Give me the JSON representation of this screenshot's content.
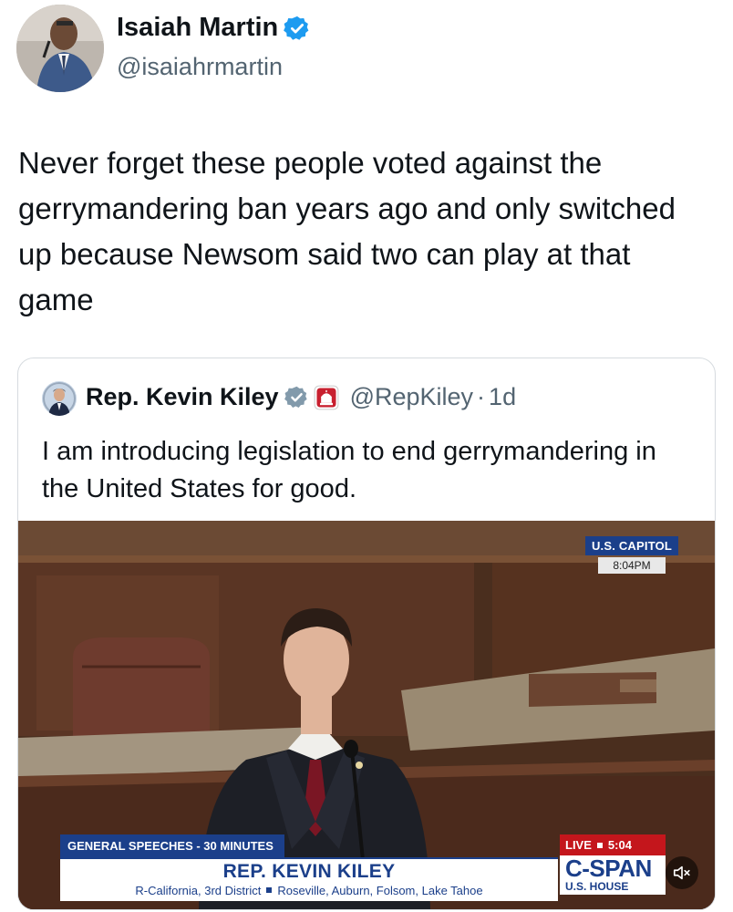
{
  "tweet": {
    "author_name": "Isaiah Martin",
    "handle": "@isaiahrmartin",
    "text": "Never forget these people voted against the gerrymandering ban years ago and only switched up because Newsom said two can play at that game"
  },
  "quoted_tweet": {
    "author_name": "Rep. Kevin Kiley",
    "handle": "@RepKiley",
    "separator": "·",
    "time": "1d",
    "text": "I am introducing legislation to end gerrymandering in the United States for good.",
    "video": {
      "location_label": "U.S. CAPITOL",
      "location_time": "8:04PM",
      "program_label": "GENERAL SPEECHES - 30 MINUTES",
      "speaker_name": "REP. KEVIN KILEY",
      "speaker_party": "R-California, 3rd District",
      "speaker_area": "Roseville, Auburn, Folsom, Lake Tahoe",
      "live_label": "LIVE",
      "live_time": "5:04",
      "network_name": "C-SPAN",
      "network_sub": "U.S. HOUSE"
    }
  },
  "icons": {
    "verified": "verified-badge-icon",
    "government_badge": "capitol-badge-icon",
    "mute": "speaker-muted-icon"
  },
  "colors": {
    "verified_blue": "#1d9bf0",
    "verified_gray": "#829aab",
    "cspan_blue": "#1b3f8a",
    "live_red": "#c4161c",
    "muted_text": "#536471"
  }
}
